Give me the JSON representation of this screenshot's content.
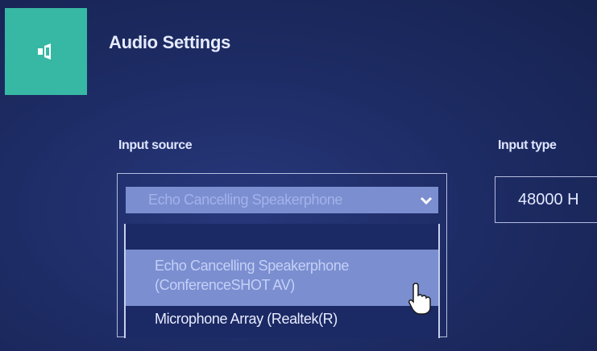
{
  "header": {
    "icon": "speaker-icon",
    "title": "Audio Settings"
  },
  "input_source": {
    "label": "Input source",
    "selected_value": "Echo Cancelling Speakerphone",
    "options": [
      {
        "line1": "Echo Cancelling Speakerphone",
        "line2": "(ConferenceSHOT AV)"
      },
      {
        "line1": "Microphone Array (Realtek(R)",
        "line2": ""
      }
    ]
  },
  "input_type": {
    "label": "Input type",
    "value": "48000 H"
  },
  "colors": {
    "accent": "#37b8a4",
    "background": "#1e2c66",
    "highlight": "#7b8ed0"
  }
}
